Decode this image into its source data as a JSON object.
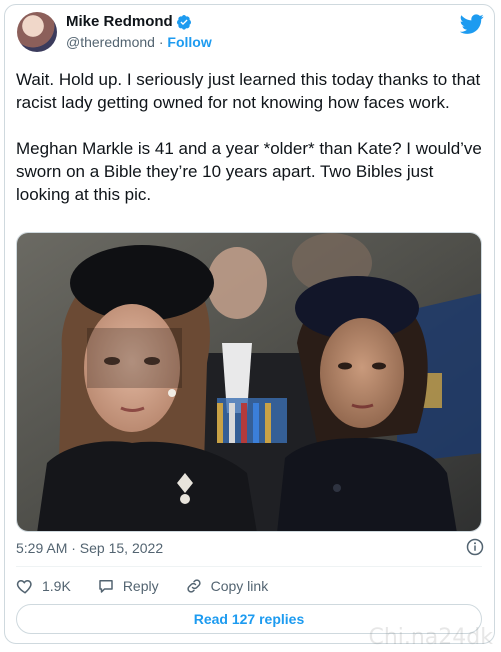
{
  "user": {
    "name": "Mike Redmond",
    "handle": "@theredmond",
    "separator": " · ",
    "follow_label": "Follow"
  },
  "tweet": {
    "text": "Wait. Hold up. I seriously just learned this today thanks to that racist lady getting owned for not knowing how faces work.\n\nMeghan Markle is 41 and a year *older* than Kate? I would’ve sworn on a Bible they’re 10 years apart. Two Bibles just looking at this pic.",
    "timestamp": "5:29 AM · Sep 15, 2022"
  },
  "actions": {
    "like_count": "1.9K",
    "reply_label": "Reply",
    "copy_link_label": "Copy link"
  },
  "read_replies_label": "Read 127 replies",
  "watermark_text": "Chi.na24dk",
  "icons": {
    "verified": "verified-badge-icon",
    "logo": "twitter-bird-icon",
    "info": "info-icon",
    "like": "heart-icon",
    "reply": "speech-bubble-icon",
    "link": "link-icon"
  },
  "colors": {
    "accent": "#1d9bf0",
    "text": "#0f1419",
    "secondary": "#536471",
    "border": "#cfd9de"
  }
}
